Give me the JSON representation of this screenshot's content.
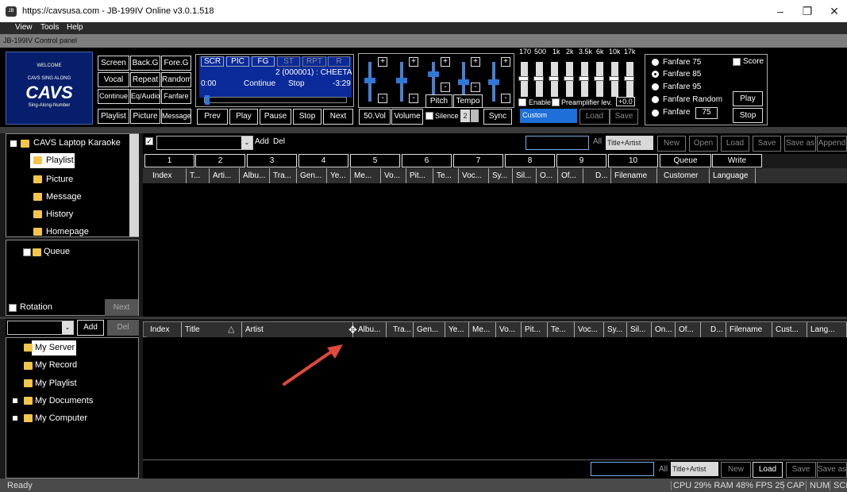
{
  "window": {
    "title": "https://cavsusa.com - JB-199IV Online v3.0.1.518",
    "minimize": "–",
    "restore": "❐",
    "close": "✕",
    "logo": "JB"
  },
  "menu": [
    "View",
    "Tools",
    "Help"
  ],
  "control_panel_label": "JB-199IV Control panel",
  "logo_text": {
    "line1": "WELCOME",
    "line2": "CAVS SING ALONG",
    "brand": "CAVS",
    "line3": "Sing-Along-Number"
  },
  "left_buttons": [
    "Screen",
    "Back.G",
    "Fore.G",
    "Vocal",
    "Repeat",
    "Random",
    "Continue",
    "Eq/Audio",
    "Fanfare",
    "Playlist",
    "Picture",
    "Message"
  ],
  "player": {
    "modes": [
      "SCR",
      "PIC",
      "FG",
      "ST",
      "RPT",
      "R"
    ],
    "track": "2 (000001) : CHEETA",
    "elapsed": "0:00",
    "mode": "Continue",
    "state": "Stop",
    "remaining": "-3:29",
    "progress": 0.03,
    "buttons": [
      "Prev",
      "Play",
      "Pause",
      "Stop",
      "Next"
    ]
  },
  "mixer": {
    "vol_label": "50.Vol",
    "volume_label": "Volume",
    "silence_label": "Silence",
    "silence_value": "2",
    "pitch_label": "Pitch",
    "tempo_label": "Tempo",
    "sync_label": "Sync",
    "plus": "+",
    "minus": "-"
  },
  "eq": {
    "bands": [
      "170",
      "500",
      "1k",
      "2k",
      "3.5k",
      "6k",
      "10k",
      "17k"
    ],
    "enable_label": "Enable",
    "preamp_label": "Preamplifier lev.",
    "preamp_value": "+0.0",
    "preset": "Custom",
    "load": "Load",
    "save": "Save"
  },
  "fanfare": {
    "options": [
      "Fanfare 75",
      "Fanfare 85",
      "Fanfare 95",
      "Fanfare Random",
      "Fanfare"
    ],
    "selected": "Fanfare 85",
    "value": "75",
    "score_label": "Score",
    "play": "Play",
    "stop": "Stop"
  },
  "tree_top": {
    "root": "CAVS Laptop Karaoke",
    "items": [
      "Playlist",
      "Picture",
      "Message",
      "History",
      "Homepage"
    ],
    "selected": "Playlist",
    "queue": "Queue",
    "rotation": "Rotation",
    "next": "Next"
  },
  "playlist_toolbar": {
    "add": "Add",
    "del": "Del",
    "all": "All",
    "filter": "Title+Artist",
    "new": "New",
    "open": "Open",
    "load": "Load",
    "save": "Save",
    "save_as": "Save as",
    "append": "Append"
  },
  "playlist_tabs": [
    "1",
    "2",
    "3",
    "4",
    "5",
    "6",
    "7",
    "8",
    "9",
    "10",
    "Queue",
    "Write"
  ],
  "playlist_columns": [
    "Index",
    "T...",
    "Arti...",
    "Albu...",
    "Tra...",
    "Gen...",
    "Ye...",
    "Me...",
    "Vo...",
    "Pit...",
    "Te...",
    "Voc...",
    "Sy...",
    "Sil...",
    "O...",
    "Of...",
    "D...",
    "Filename",
    "Customer",
    "Language"
  ],
  "bottom_left": {
    "add": "Add",
    "del": "Del",
    "items": [
      "My Server",
      "My Record",
      "My Playlist",
      "My Documents",
      "My Computer"
    ],
    "selected": "My Server"
  },
  "browser_columns": [
    "Index",
    "Title",
    "Artist",
    "Albu...",
    "Tra...",
    "Gen...",
    "Ye...",
    "Me...",
    "Vo...",
    "Pit...",
    "Te...",
    "Voc...",
    "Sy...",
    "Sil...",
    "On...",
    "Of...",
    "D...",
    "Filename",
    "Cust...",
    "Lang..."
  ],
  "browser_toolbar": {
    "all": "All",
    "filter": "Title+Artist",
    "new": "New",
    "load": "Load",
    "save": "Save",
    "save_as": "Save as"
  },
  "status": {
    "left": "Ready",
    "stats": "CPU 29% RAM 48% FPS 25",
    "cap": "CAP",
    "num": "NUM",
    "scr": "SCR"
  },
  "colors": {
    "accent": "#2f78d8",
    "panel": "#000000",
    "folder": "#f3c54a",
    "arrow": "#e04a3a"
  }
}
